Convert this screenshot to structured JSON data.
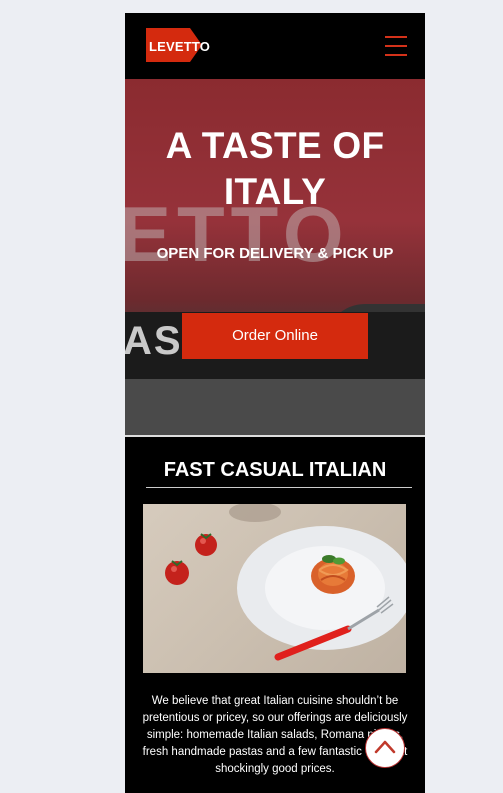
{
  "header": {
    "logo_text": "LEVETTO",
    "menu_icon": "hamburger-menu-icon",
    "brand_color": "#d42a0e"
  },
  "hero": {
    "title_line1": "A TASTE OF",
    "title_line2": "ITALY",
    "subtitle": "OPEN FOR DELIVERY & PICK UP",
    "order_button_label": "Order Online",
    "background_sign_text": "ETTO",
    "background_band_text": "ASTA BA"
  },
  "section": {
    "title": "FAST CASUAL ITALIAN",
    "image": "plate-of-spaghetti-with-tomatoes-and-fork",
    "body_text": "We believe that great Italian cuisine shouldn’t be pretentious or pricey, so our offerings are deliciously simple: homemade Italian salads, Romana pizzas, fresh handmade pastas and a few fantastic wines at shockingly good prices."
  },
  "scroll_top_icon": "chevron-up-icon"
}
